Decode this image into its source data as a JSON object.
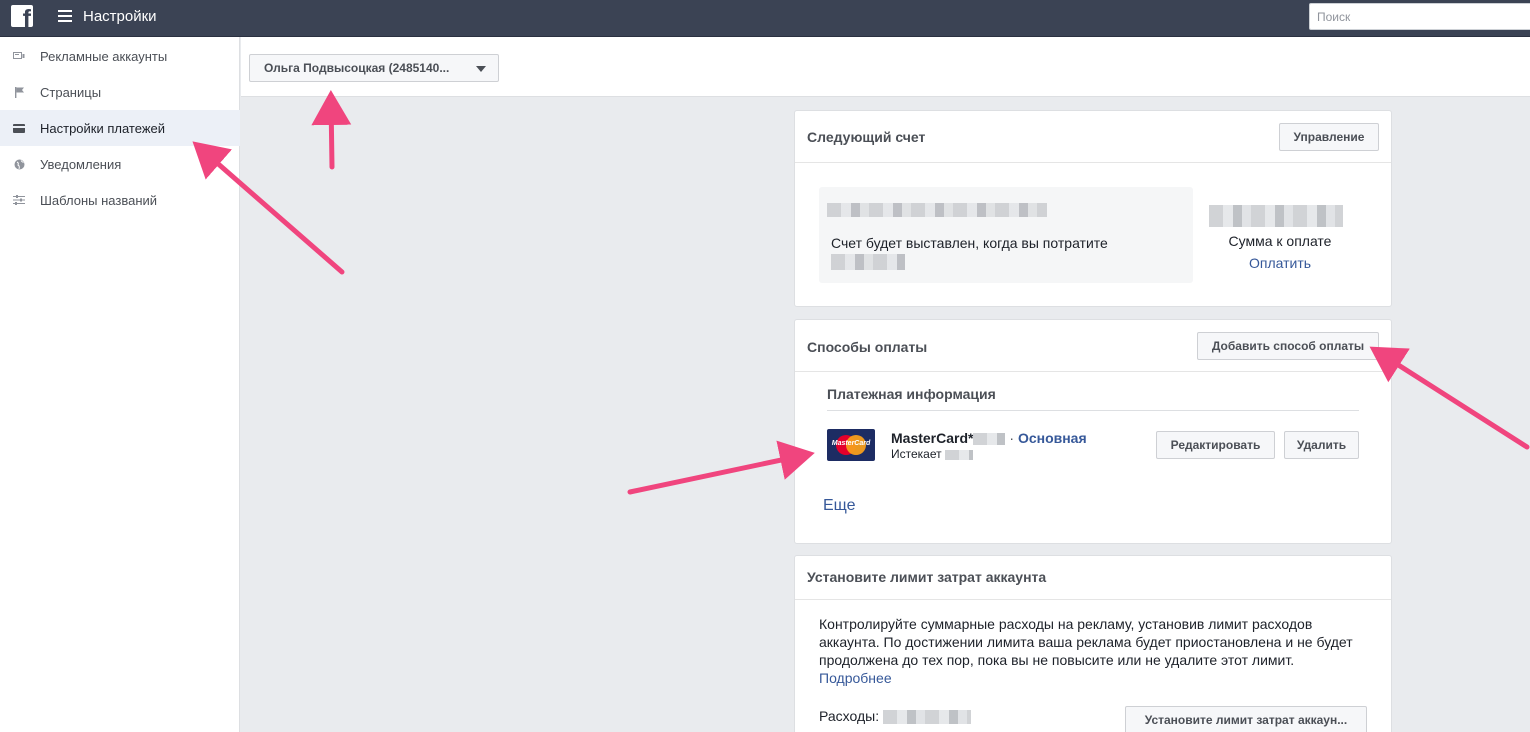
{
  "topbar": {
    "logo_letter": "f",
    "title": "Настройки",
    "search_placeholder": "Поиск"
  },
  "sidebar": {
    "items": [
      {
        "label": "Рекламные аккаунты",
        "icon": "ad-accounts-icon"
      },
      {
        "label": "Страницы",
        "icon": "flag-icon"
      },
      {
        "label": "Настройки платежей",
        "icon": "credit-card-icon",
        "active": true
      },
      {
        "label": "Уведомления",
        "icon": "globe-icon"
      },
      {
        "label": "Шаблоны названий",
        "icon": "sliders-icon"
      }
    ]
  },
  "account_selector": {
    "label": "Ольга Подвысоцкая (2485140..."
  },
  "next_bill": {
    "title": "Следующий счет",
    "manage_label": "Управление",
    "bill_text": "Счет будет выставлен, когда вы потратите",
    "amount_due_label": "Сумма к оплате",
    "pay_label": "Оплатить"
  },
  "payment_methods": {
    "title": "Способы оплаты",
    "add_label": "Добавить способ оплаты",
    "section_title": "Платежная информация",
    "card": {
      "brand": "MasterCard*",
      "logo_text": "MasterCard",
      "separator": "·",
      "primary_label": "Основная",
      "expires_label": "Истекает"
    },
    "edit_label": "Редактировать",
    "delete_label": "Удалить",
    "more_label": "Еще"
  },
  "spend_limit": {
    "title": "Установите лимит затрат аккаунта",
    "description": "Контролируйте суммарные расходы на рекламу, установив лимит расходов аккаунта. По достижении лимита ваша реклама будет приостановлена и не будет продолжена до тех пор, пока вы не повысите или не удалите этот лимит.",
    "more_link": "Подробнее",
    "spent_label": "Расходы:",
    "set_limit_label": "Установите лимит затрат аккаун..."
  },
  "colors": {
    "topbar": "#3b4354",
    "link": "#365899",
    "arrow": "#f0457e",
    "background": "#e9ebee"
  }
}
